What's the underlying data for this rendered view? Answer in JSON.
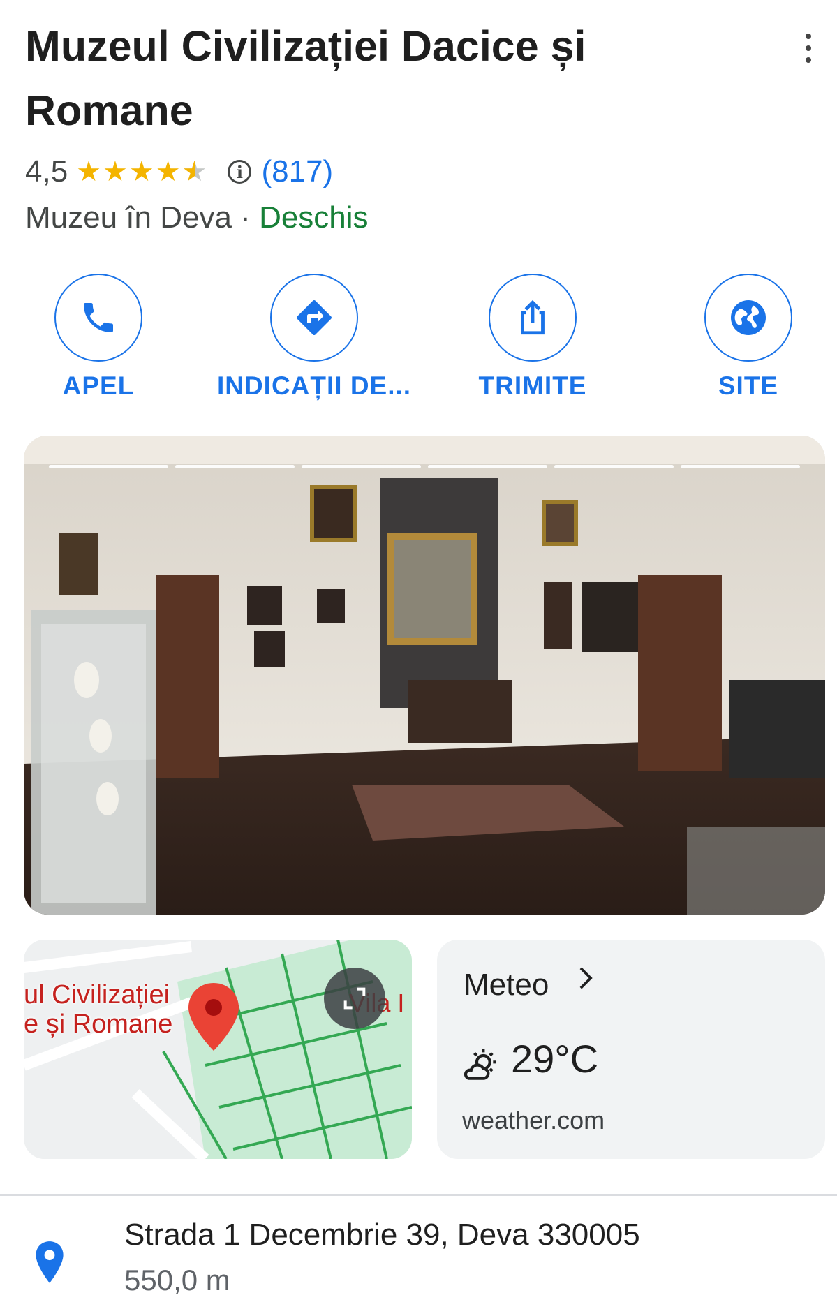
{
  "place": {
    "name": "Muzeul Civilizației Dacice și Romane",
    "rating": "4,5",
    "rating_value": 4.5,
    "review_count": "(817)",
    "category": "Muzeu în Deva",
    "separator": "·",
    "status": "Deschis"
  },
  "actions": [
    {
      "label": "APEL",
      "icon": "phone-icon"
    },
    {
      "label": "INDICAȚII DE...",
      "icon": "directions-icon"
    },
    {
      "label": "TRIMITE",
      "icon": "share-icon"
    },
    {
      "label": "SITE",
      "icon": "globe-icon"
    }
  ],
  "photo": {
    "slides_total": 6,
    "slides_seen": 6
  },
  "map": {
    "place_label_line1": "ul Civilizației",
    "place_label_line2": "e și Romane",
    "nearby_label": "Vila I"
  },
  "weather": {
    "title": "Meteo",
    "temperature": "29°C",
    "condition_icon": "partly-sunny-icon",
    "source": "weather.com"
  },
  "address": {
    "line": "Strada 1 Decembrie 39, Deva 330005",
    "distance": "550,0 m"
  },
  "colors": {
    "accent": "#1a73e8",
    "open": "#188038",
    "star": "#f4b400",
    "map_marker": "#ea4335"
  }
}
